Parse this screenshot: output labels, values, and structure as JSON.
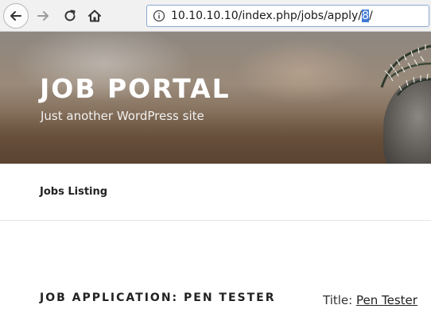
{
  "browser": {
    "url_prefix": "10.10.10.10/index.php/jobs/apply/",
    "url_selected": "8",
    "url_suffix": "/",
    "icons": {
      "back": "back-arrow-icon",
      "forward": "forward-arrow-icon",
      "reload": "reload-icon",
      "home": "home-icon",
      "info": "info-icon"
    }
  },
  "site": {
    "title": "JOB PORTAL",
    "description": "Just another WordPress site"
  },
  "nav": {
    "items": [
      {
        "label": "Jobs Listing"
      }
    ]
  },
  "content": {
    "heading": "JOB APPLICATION: PEN TESTER",
    "title_label": "Title:",
    "title_value": "Pen Tester"
  }
}
